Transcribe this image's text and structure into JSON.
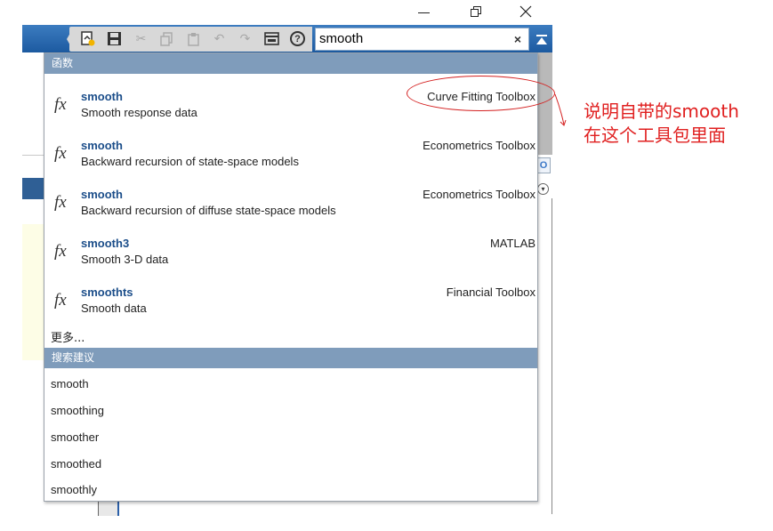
{
  "window": {
    "controls": [
      "minimize",
      "restore",
      "close"
    ]
  },
  "toolbar": {
    "icons": [
      "new-file-icon",
      "save-icon",
      "cut-icon",
      "copy-icon",
      "paste-icon",
      "undo-icon",
      "redo-icon",
      "switch-window-icon",
      "help-icon"
    ],
    "help_label": "?",
    "search_value": "smooth",
    "clear_label": "×"
  },
  "popup": {
    "functions_header": "函数",
    "functions": [
      {
        "name": "smooth",
        "desc": "Smooth response data",
        "toolbox": "Curve Fitting Toolbox"
      },
      {
        "name": "smooth",
        "desc": "Backward recursion of state-space models",
        "toolbox": "Econometrics Toolbox"
      },
      {
        "name": "smooth",
        "desc": "Backward recursion of diffuse state-space models",
        "toolbox": "Econometrics Toolbox"
      },
      {
        "name": "smooth3",
        "desc": "Smooth 3-D data",
        "toolbox": "MATLAB"
      },
      {
        "name": "smoothts",
        "desc": "Smooth data",
        "toolbox": "Financial Toolbox"
      }
    ],
    "fx_label": "fx",
    "more_label": "更多...",
    "suggestions_header": "搜索建议",
    "suggestions": [
      "smooth",
      "smoothing",
      "smoother",
      "smoothed",
      "smoothly"
    ]
  },
  "annotation": {
    "line1": "说明自带的smooth",
    "line2": "在这个工具包里面",
    "color": "#e02020"
  },
  "colors": {
    "toolbar_blue": "#1e5fa6",
    "header_blue": "#7f9cbb",
    "name_blue": "#1c4e8a"
  }
}
